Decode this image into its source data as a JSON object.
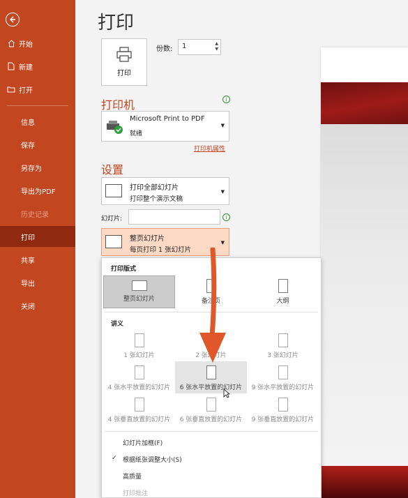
{
  "sidebar": {
    "back_icon": "back-arrow-icon",
    "items": [
      {
        "label": "开始",
        "icon": "home-icon"
      },
      {
        "label": "新建",
        "icon": "new-doc-icon"
      },
      {
        "label": "打开",
        "icon": "folder-icon"
      },
      {
        "label": "信息"
      },
      {
        "label": "保存"
      },
      {
        "label": "另存为"
      },
      {
        "label": "导出为PDF"
      },
      {
        "label": "历史记录"
      },
      {
        "label": "打印",
        "active": true
      },
      {
        "label": "共享"
      },
      {
        "label": "导出"
      },
      {
        "label": "关闭"
      }
    ]
  },
  "main": {
    "title": "打印",
    "print_button_label": "打印",
    "copies_label": "份数:",
    "copies_value": "1",
    "printer": {
      "heading": "打印机",
      "name": "Microsoft Print to PDF",
      "status": "就绪",
      "properties_link": "打印机属性"
    },
    "settings": {
      "heading": "设置",
      "range_line1": "打印全部幻灯片",
      "range_line2": "打印整个演示文稿",
      "slides_label": "幻灯片:",
      "slides_value": "",
      "layout_line1": "整页幻灯片",
      "layout_line2": "每页打印 1 张幻灯片"
    }
  },
  "dropdown": {
    "layout_header": "打印版式",
    "layouts": [
      "整页幻灯片",
      "备注页",
      "大纲"
    ],
    "handouts_header": "讲义",
    "handouts": [
      "1 张幻灯片",
      "2 张幻灯片",
      "3 张幻灯片",
      "4 张水平放置的幻灯片",
      "6 张水平放置的幻灯片",
      "9 张水平放置的幻灯片",
      "4 张垂直放置的幻灯片",
      "6 张垂直放置的幻灯片",
      "9 张垂直放置的幻灯片"
    ],
    "options": [
      {
        "label": "幻灯片加框(F)",
        "checked": false
      },
      {
        "label": "根据纸张调整大小(S)",
        "checked": true
      },
      {
        "label": "高质量",
        "checked": false
      },
      {
        "label": "打印批注",
        "checked": false
      }
    ]
  },
  "colors": {
    "sidebar": "#c2461f",
    "sidebar_active": "#8f2a10",
    "accent": "#c2461f",
    "highlight": "#fcd9c4",
    "arrow": "#e0572a"
  }
}
